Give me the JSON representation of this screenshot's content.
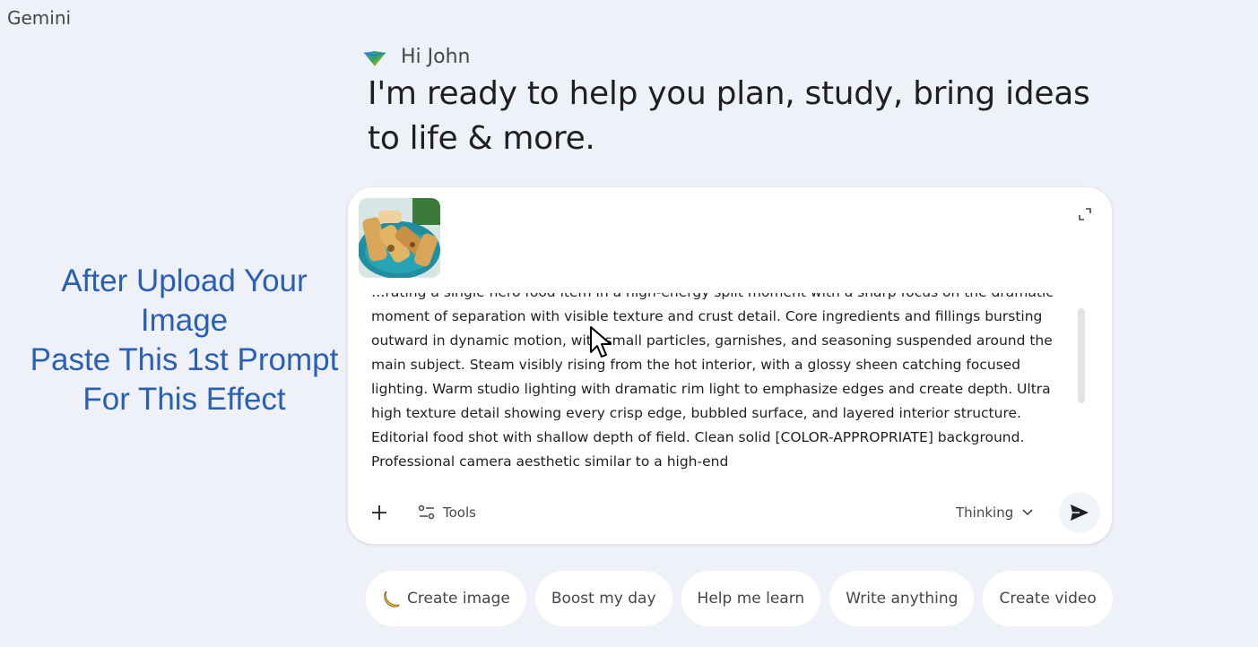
{
  "app": {
    "title": "Gemini"
  },
  "greeting": {
    "text": "Hi John",
    "icon": "gemini-spark-icon"
  },
  "headline": "I'm ready to help you plan, study, bring ideas to life & more.",
  "overlay_caption": "After Upload Your\nImage\nPaste This 1st Prompt\nFor This Effect",
  "prompt": {
    "attachment": "food-image-thumbnail",
    "text": "…rating a single hero food item in a high-energy split moment with a sharp focus on the dramatic moment of separation with visible texture and crust detail. Core ingredients and fillings bursting outward in dynamic motion, with small particles, garnishes, and seasoning suspended around the main subject. Steam visibly rising from the hot interior, with a glossy sheen catching focused lighting. Warm studio lighting with dramatic rim light to emphasize edges and create depth. Ultra high texture detail showing every crisp edge, bubbled surface, and layered interior structure. Editorial food shot with shallow depth of field. Clean solid [COLOR-APPROPRIATE] background. Professional camera aesthetic similar to a high-end",
    "tools_label": "Tools",
    "model_label": "Thinking",
    "icons": {
      "expand": "expand-icon",
      "plus": "plus-icon",
      "tools": "tools-icon",
      "chevron": "chevron-down-icon",
      "send": "send-icon"
    }
  },
  "suggestions": [
    {
      "label": "Create image",
      "icon": "banana-icon"
    },
    {
      "label": "Boost my day"
    },
    {
      "label": "Help me learn"
    },
    {
      "label": "Write anything"
    },
    {
      "label": "Create video"
    }
  ],
  "colors": {
    "background": "#eef2f8",
    "caption": "#2a5fb8",
    "card": "#ffffff"
  }
}
